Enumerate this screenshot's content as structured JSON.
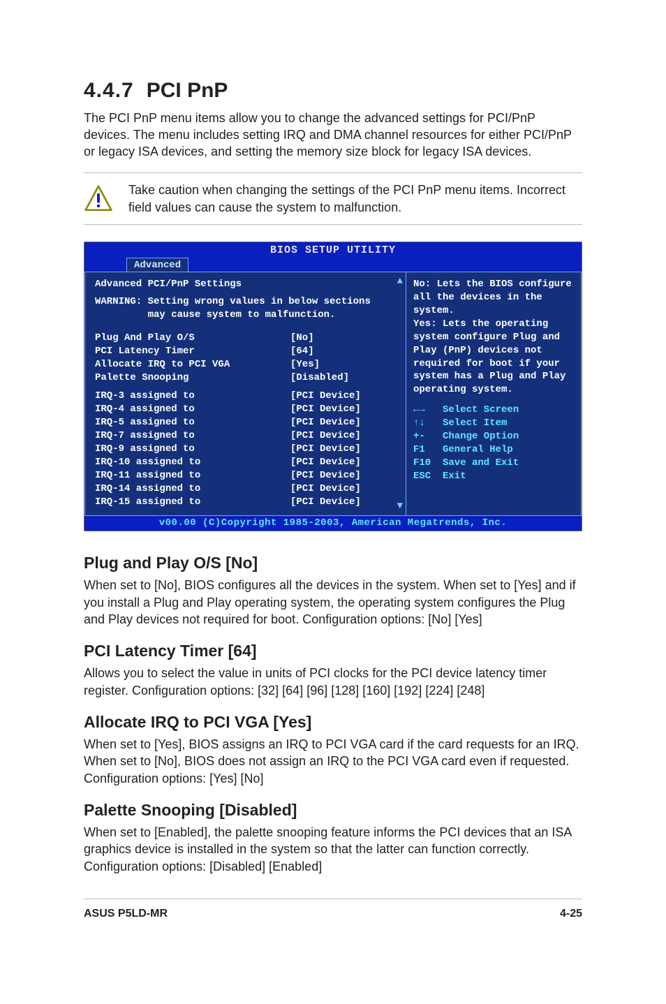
{
  "section": {
    "number": "4.4.7",
    "title": "PCI PnP"
  },
  "intro": "The PCI PnP menu items allow you to change the advanced settings for PCI/PnP devices. The menu includes setting IRQ and DMA channel resources for either PCI/PnP or legacy ISA devices, and setting the memory size block for legacy ISA devices.",
  "caution": "Take caution when changing the settings of the PCI PnP menu items. Incorrect field values can cause the system to malfunction.",
  "bios": {
    "title": "BIOS SETUP UTILITY",
    "tab": "Advanced",
    "headline": "Advanced PCI/PnP Settings",
    "warning_l1": "WARNING: Setting wrong values in below sections",
    "warning_l2": "         may cause system to malfunction.",
    "opts": [
      {
        "k": "Plug And Play O/S",
        "v": "[No]"
      },
      {
        "k": "PCI Latency Timer",
        "v": "[64]"
      },
      {
        "k": "Allocate IRQ to PCI VGA",
        "v": "[Yes]"
      },
      {
        "k": "Palette Snooping",
        "v": "[Disabled]"
      }
    ],
    "irqs": [
      {
        "k": "IRQ-3 assigned to",
        "v": "[PCI Device]"
      },
      {
        "k": "IRQ-4 assigned to",
        "v": "[PCI Device]"
      },
      {
        "k": "IRQ-5 assigned to",
        "v": "[PCI Device]"
      },
      {
        "k": "IRQ-7 assigned to",
        "v": "[PCI Device]"
      },
      {
        "k": "IRQ-9 assigned to",
        "v": "[PCI Device]"
      },
      {
        "k": "IRQ-10 assigned to",
        "v": "[PCI Device]"
      },
      {
        "k": "IRQ-11 assigned to",
        "v": "[PCI Device]"
      },
      {
        "k": "IRQ-14 assigned to",
        "v": "[PCI Device]"
      },
      {
        "k": "IRQ-15 assigned to",
        "v": "[PCI Device]"
      }
    ],
    "help": "No: Lets the BIOS configure all the devices in the system.\nYes: Lets the operating system configure Plug and Play (PnP) devices not required for boot if your system has a Plug and Play operating system.",
    "keys": [
      {
        "k": "←→",
        "d": "Select Screen",
        "cyan": true
      },
      {
        "k": "↑↓",
        "d": "Select Item",
        "cyan": true
      },
      {
        "k": "+-",
        "d": "Change Option",
        "cyan": true
      },
      {
        "k": "F1",
        "d": "General Help",
        "cyan": true
      },
      {
        "k": "F10",
        "d": "Save and Exit",
        "cyan": true
      },
      {
        "k": "ESC",
        "d": "Exit",
        "cyan": true
      }
    ],
    "footer": "v00.00 (C)Copyright 1985-2003, American Megatrends, Inc."
  },
  "subs": [
    {
      "title": "Plug and Play O/S [No]",
      "body": "When set to [No], BIOS configures all the devices in the system. When set to [Yes] and if you install a Plug and Play operating system, the operating system configures the Plug and Play devices not required for boot. Configuration options: [No] [Yes]"
    },
    {
      "title": "PCI Latency Timer [64]",
      "body": "Allows you to select the value in units of PCI clocks for the PCI device latency timer register. Configuration options: [32] [64] [96] [128] [160] [192] [224] [248]"
    },
    {
      "title": "Allocate IRQ to PCI VGA [Yes]",
      "body": "When set to [Yes], BIOS assigns an IRQ to PCI VGA card if the card requests for an IRQ. When set to [No], BIOS does not assign an IRQ to the PCI VGA card even if requested. Configuration options: [Yes] [No]"
    },
    {
      "title": "Palette Snooping [Disabled]",
      "body": "When set to [Enabled], the palette snooping feature informs the PCI devices that an ISA graphics device is installed in the system so that the latter can function correctly. Configuration options: [Disabled] [Enabled]"
    }
  ],
  "footer": {
    "left": "ASUS P5LD-MR",
    "right": "4-25"
  }
}
